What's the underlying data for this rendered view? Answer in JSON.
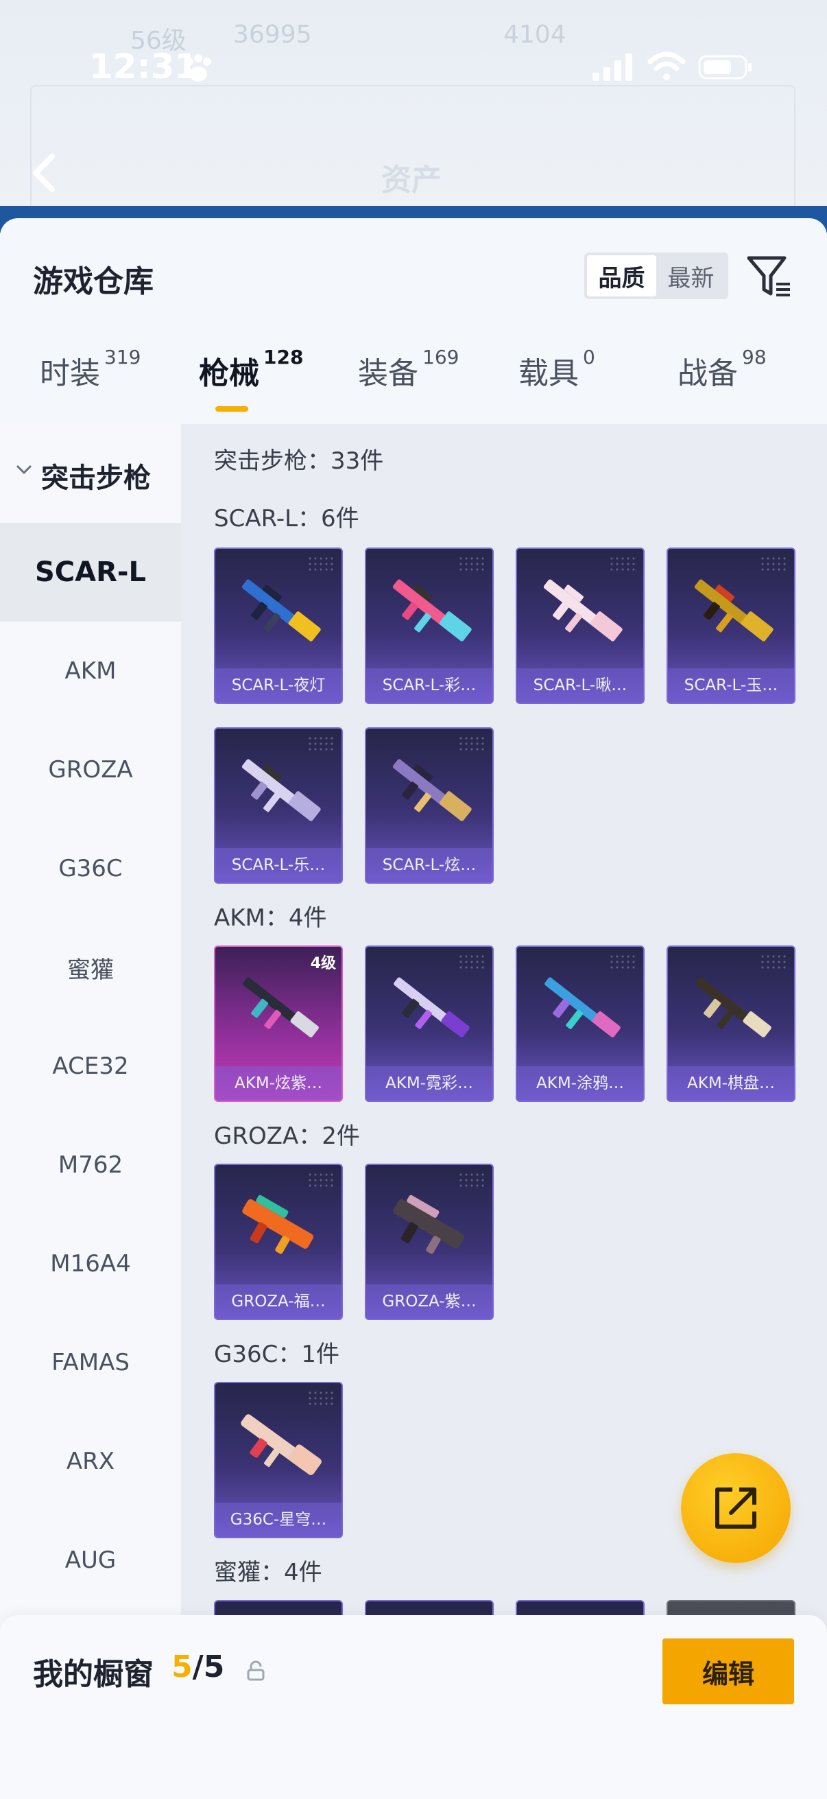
{
  "status_bar": {
    "time": "12:31"
  },
  "background_header": {
    "title": "资产",
    "faded_left": "56级",
    "faded_score": "36995",
    "faded_right": "4104"
  },
  "sheet": {
    "title": "游戏仓库",
    "sort_options": [
      "品质",
      "最新"
    ],
    "active_sort": "品质"
  },
  "tabs": [
    {
      "label": "时装",
      "count": "319"
    },
    {
      "label": "枪械",
      "count": "128"
    },
    {
      "label": "装备",
      "count": "169"
    },
    {
      "label": "载具",
      "count": "0"
    },
    {
      "label": "战备",
      "count": "98"
    }
  ],
  "active_tab": "枪械",
  "left_nav": {
    "group": "突击步枪",
    "items": [
      "SCAR-L",
      "AKM",
      "GROZA",
      "G36C",
      "蜜獾",
      "ACE32",
      "M762",
      "M16A4",
      "FAMAS",
      "ARX",
      "AUG"
    ],
    "active": "SCAR-L"
  },
  "content": {
    "summary": "突击步枪：33件",
    "sections": [
      {
        "label": "SCAR-L：6件",
        "items": [
          {
            "name": "SCAR-L-夜灯",
            "rarity": "blue"
          },
          {
            "name": "SCAR-L-彩…",
            "rarity": "blue"
          },
          {
            "name": "SCAR-L-啾…",
            "rarity": "blue"
          },
          {
            "name": "SCAR-L-玉…",
            "rarity": "blue"
          },
          {
            "name": "SCAR-L-乐…",
            "rarity": "blue"
          },
          {
            "name": "SCAR-L-炫…",
            "rarity": "blue"
          }
        ]
      },
      {
        "label": "AKM：4件",
        "items": [
          {
            "name": "AKM-炫紫…",
            "rarity": "purple",
            "tier": "4级"
          },
          {
            "name": "AKM-霓彩…",
            "rarity": "blue"
          },
          {
            "name": "AKM-涂鸦…",
            "rarity": "blue"
          },
          {
            "name": "AKM-棋盘…",
            "rarity": "blue"
          }
        ]
      },
      {
        "label": "GROZA：2件",
        "items": [
          {
            "name": "GROZA-福…",
            "rarity": "blue"
          },
          {
            "name": "GROZA-紫…",
            "rarity": "blue"
          }
        ]
      },
      {
        "label": "G36C：1件",
        "items": [
          {
            "name": "G36C-星穹…",
            "rarity": "blue"
          }
        ]
      },
      {
        "label": "蜜獾：4件",
        "items": []
      }
    ]
  },
  "bottom_bar": {
    "label": "我的橱窗",
    "current": "5",
    "total": "/5",
    "edit": "编辑"
  },
  "colors": {
    "accent": "#f5b000",
    "rarity_blue": "#7a68d4",
    "rarity_purple": "#d65fc6"
  }
}
